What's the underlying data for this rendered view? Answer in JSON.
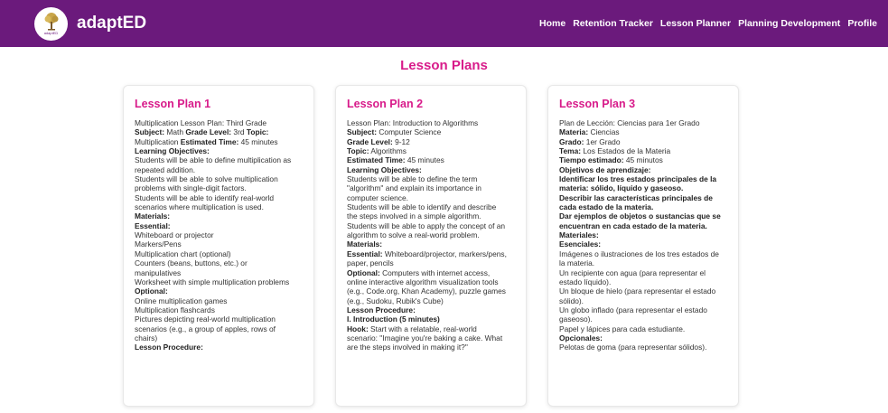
{
  "app": {
    "name": "adaptED",
    "logo_text": "adaptED"
  },
  "nav": {
    "items": [
      {
        "label": "Home"
      },
      {
        "label": "Retention Tracker"
      },
      {
        "label": "Lesson Planner"
      },
      {
        "label": "Planning Development"
      },
      {
        "label": "Profile"
      }
    ]
  },
  "page": {
    "title": "Lesson Plans"
  },
  "colors": {
    "nav_bg": "#6b1a7c",
    "accent": "#d81b8a"
  },
  "cards": [
    {
      "title": "Lesson Plan 1",
      "lines": [
        {
          "t": "Multiplication Lesson Plan: Third Grade"
        },
        {
          "s": [
            {
              "t": "Subject:",
              "b": true
            },
            {
              "t": " Math "
            },
            {
              "t": "Grade Level:",
              "b": true
            },
            {
              "t": " 3rd "
            },
            {
              "t": "Topic:",
              "b": true
            }
          ]
        },
        {
          "s": [
            {
              "t": "Multiplication "
            },
            {
              "t": "Estimated Time:",
              "b": true
            },
            {
              "t": " 45 minutes"
            }
          ]
        },
        {
          "t": "Learning Objectives:",
          "b": true
        },
        {
          "t": "Students will be able to define multiplication as"
        },
        {
          "t": "repeated addition."
        },
        {
          "t": "Students will be able to solve multiplication"
        },
        {
          "t": "problems with single-digit factors."
        },
        {
          "t": "Students will be able to identify real-world"
        },
        {
          "t": "scenarios where multiplication is used."
        },
        {
          "t": "Materials:",
          "b": true
        },
        {
          "t": "Essential:",
          "b": true
        },
        {
          "t": "Whiteboard or projector"
        },
        {
          "t": "Markers/Pens"
        },
        {
          "t": "Multiplication chart (optional)"
        },
        {
          "t": "Counters (beans, buttons, etc.) or"
        },
        {
          "t": "manipulatives"
        },
        {
          "t": "Worksheet with simple multiplication problems"
        },
        {
          "t": "Optional:",
          "b": true
        },
        {
          "t": "Online multiplication games"
        },
        {
          "t": "Multiplication flashcards"
        },
        {
          "t": "Pictures depicting real-world multiplication"
        },
        {
          "t": "scenarios (e.g., a group of apples, rows of"
        },
        {
          "t": "chairs)"
        },
        {
          "t": "Lesson Procedure:",
          "b": true
        }
      ]
    },
    {
      "title": "Lesson Plan 2",
      "lines": [
        {
          "t": "Lesson Plan: Introduction to Algorithms"
        },
        {
          "s": [
            {
              "t": "Subject:",
              "b": true
            },
            {
              "t": " Computer Science"
            }
          ]
        },
        {
          "s": [
            {
              "t": "Grade Level:",
              "b": true
            },
            {
              "t": " 9-12"
            }
          ]
        },
        {
          "s": [
            {
              "t": "Topic:",
              "b": true
            },
            {
              "t": " Algorithms"
            }
          ]
        },
        {
          "s": [
            {
              "t": "Estimated Time:",
              "b": true
            },
            {
              "t": " 45 minutes"
            }
          ]
        },
        {
          "t": "Learning Objectives:",
          "b": true
        },
        {
          "t": "Students will be able to define the term"
        },
        {
          "t": "\"algorithm\" and explain its importance in"
        },
        {
          "t": "computer science."
        },
        {
          "t": "Students will be able to identify and describe"
        },
        {
          "t": "the steps involved in a simple algorithm."
        },
        {
          "t": "Students will be able to apply the concept of an"
        },
        {
          "t": "algorithm to solve a real-world problem."
        },
        {
          "t": "Materials:",
          "b": true
        },
        {
          "s": [
            {
              "t": "Essential:",
              "b": true
            },
            {
              "t": " Whiteboard/projector, markers/pens,"
            }
          ]
        },
        {
          "t": "paper, pencils"
        },
        {
          "s": [
            {
              "t": "Optional:",
              "b": true
            },
            {
              "t": " Computers with internet access,"
            }
          ]
        },
        {
          "t": "online interactive algorithm visualization tools"
        },
        {
          "t": "(e.g., Code.org, Khan Academy), puzzle games"
        },
        {
          "t": "(e.g., Sudoku, Rubik's Cube)"
        },
        {
          "t": "Lesson Procedure:",
          "b": true
        },
        {
          "t": "I. Introduction (5 minutes)",
          "b": true
        },
        {
          "s": [
            {
              "t": "Hook:",
              "b": true
            },
            {
              "t": " Start with a relatable, real-world"
            }
          ]
        },
        {
          "t": "scenario: \"Imagine you're baking a cake. What"
        },
        {
          "t": "are the steps involved in making it?\""
        }
      ]
    },
    {
      "title": "Lesson Plan 3",
      "lines": [
        {
          "t": "Plan de Lección: Ciencias para 1er Grado"
        },
        {
          "s": [
            {
              "t": "Materia:",
              "b": true
            },
            {
              "t": " Ciencias"
            }
          ]
        },
        {
          "s": [
            {
              "t": "Grado:",
              "b": true
            },
            {
              "t": " 1er Grado"
            }
          ]
        },
        {
          "s": [
            {
              "t": "Tema:",
              "b": true
            },
            {
              "t": " Los Estados de la Materia"
            }
          ]
        },
        {
          "s": [
            {
              "t": "Tiempo estimado:",
              "b": true
            },
            {
              "t": " 45 minutos"
            }
          ]
        },
        {
          "t": "Objetivos de aprendizaje:",
          "b": true
        },
        {
          "t": "Identificar los tres estados principales de la",
          "b": true
        },
        {
          "t": "materia: sólido, líquido y gaseoso.",
          "b": true
        },
        {
          "t": "Describir las características principales de",
          "b": true
        },
        {
          "t": "cada estado de la materia.",
          "b": true
        },
        {
          "t": "Dar ejemplos de objetos o sustancias que se",
          "b": true
        },
        {
          "t": "encuentran en cada estado de la materia.",
          "b": true
        },
        {
          "t": "Materiales:",
          "b": true
        },
        {
          "t": "Esenciales:",
          "b": true
        },
        {
          "t": "Imágenes o ilustraciones de los tres estados de"
        },
        {
          "t": "la materia."
        },
        {
          "t": "Un recipiente con agua (para representar el"
        },
        {
          "t": "estado líquido)."
        },
        {
          "t": "Un bloque de hielo (para representar el estado"
        },
        {
          "t": "sólido)."
        },
        {
          "t": "Un globo inflado (para representar el estado"
        },
        {
          "t": "gaseoso)."
        },
        {
          "t": "Papel y lápices para cada estudiante."
        },
        {
          "t": "Opcionales:",
          "b": true
        },
        {
          "t": "Pelotas de goma (para representar sólidos)."
        }
      ]
    }
  ]
}
